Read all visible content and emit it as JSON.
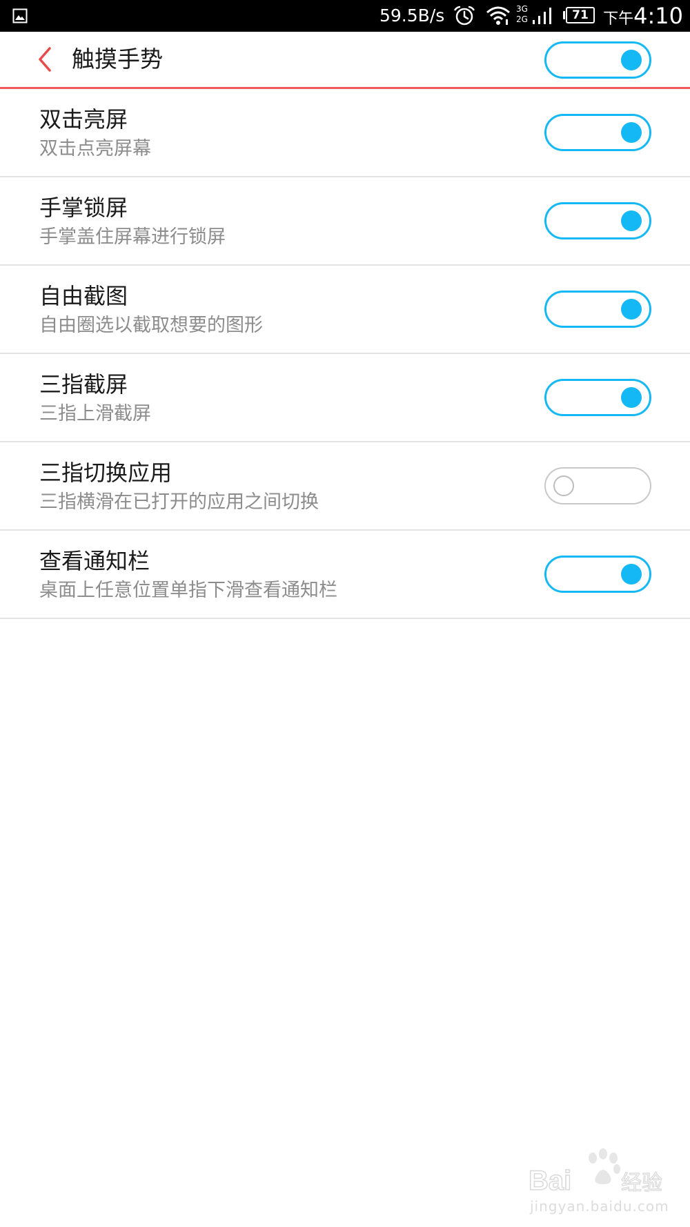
{
  "status_bar": {
    "network_speed": "59.5B/s",
    "network_type_top": "3G",
    "network_type_bottom": "2G",
    "battery_level": "71",
    "clock_ampm": "下午",
    "clock_time": "4:10"
  },
  "header": {
    "title": "触摸手势",
    "master_toggle_on": true
  },
  "settings": [
    {
      "title": "双击亮屏",
      "subtitle": "双击点亮屏幕",
      "enabled": true
    },
    {
      "title": "手掌锁屏",
      "subtitle": "手掌盖住屏幕进行锁屏",
      "enabled": true
    },
    {
      "title": "自由截图",
      "subtitle": "自由圈选以截取想要的图形",
      "enabled": true
    },
    {
      "title": "三指截屏",
      "subtitle": "三指上滑截屏",
      "enabled": true
    },
    {
      "title": "三指切换应用",
      "subtitle": "三指横滑在已打开的应用之间切换",
      "enabled": false
    },
    {
      "title": "查看通知栏",
      "subtitle": "桌面上任意位置单指下滑查看通知栏",
      "enabled": true
    }
  ],
  "watermark": {
    "logo_text": "Baidu经验",
    "url": "jingyan.baidu.com"
  },
  "colors": {
    "accent": "#13b8f5",
    "header_divider": "#f05a5a",
    "back_arrow": "#e84a4a",
    "title_text": "#1a1a1a",
    "subtitle_text": "#8c8c8c"
  },
  "icons": {
    "gallery": "gallery-icon",
    "alarm": "alarm-icon",
    "wifi": "wifi-icon",
    "signal": "signal-icon",
    "back": "back-arrow-icon"
  }
}
